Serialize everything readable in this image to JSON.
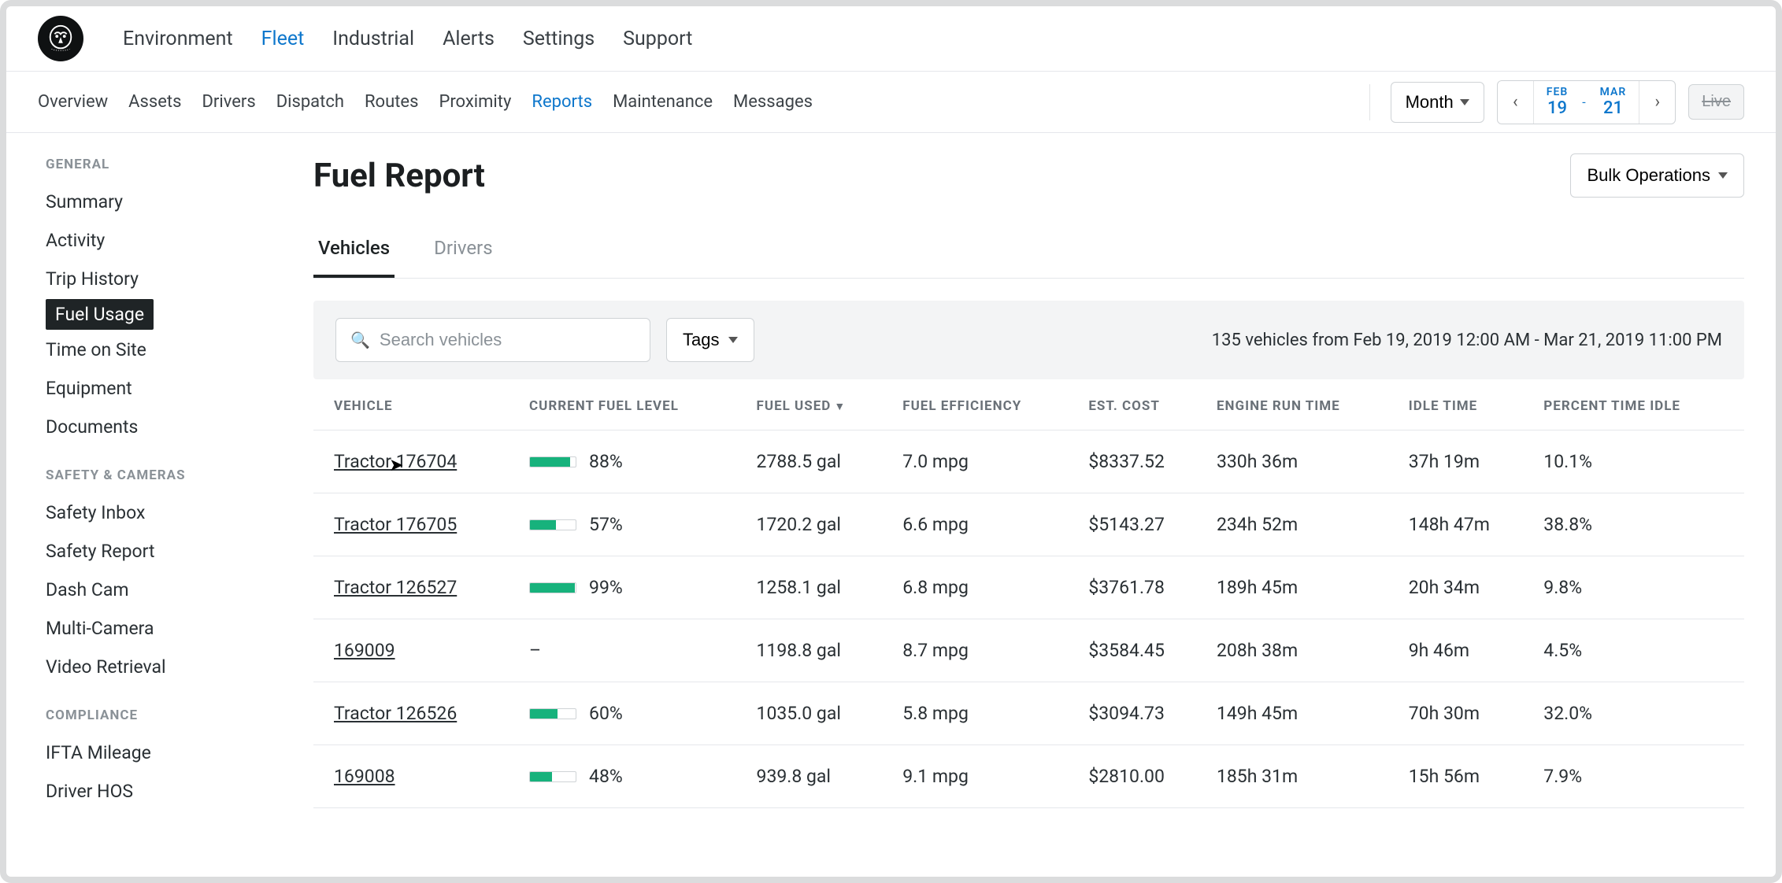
{
  "topNav": {
    "items": [
      "Environment",
      "Fleet",
      "Industrial",
      "Alerts",
      "Settings",
      "Support"
    ],
    "activeIndex": 1
  },
  "subNav": {
    "items": [
      "Overview",
      "Assets",
      "Drivers",
      "Dispatch",
      "Routes",
      "Proximity",
      "Reports",
      "Maintenance",
      "Messages"
    ],
    "activeIndex": 6,
    "monthLabel": "Month",
    "dateFrom": {
      "month": "FEB",
      "day": "19"
    },
    "dateTo": {
      "month": "MAR",
      "day": "21"
    },
    "liveLabel": "Live"
  },
  "sidebar": {
    "sections": [
      {
        "title": "GENERAL",
        "items": [
          "Summary",
          "Activity",
          "Trip History",
          "Fuel Usage",
          "Time on Site",
          "Equipment",
          "Documents"
        ],
        "selected": "Fuel Usage"
      },
      {
        "title": "SAFETY & CAMERAS",
        "items": [
          "Safety Inbox",
          "Safety Report",
          "Dash Cam",
          "Multi-Camera",
          "Video Retrieval"
        ],
        "selected": null
      },
      {
        "title": "COMPLIANCE",
        "items": [
          "IFTA Mileage",
          "Driver HOS"
        ],
        "selected": null
      }
    ]
  },
  "page": {
    "title": "Fuel Report",
    "bulkLabel": "Bulk Operations",
    "tabs": [
      "Vehicles",
      "Drivers"
    ],
    "activeTab": 0,
    "searchPlaceholder": "Search vehicles",
    "tagsLabel": "Tags",
    "summary": "135 vehicles from Feb 19, 2019 12:00 AM - Mar 21, 2019 11:00 PM"
  },
  "table": {
    "columns": [
      "VEHICLE",
      "CURRENT FUEL LEVEL",
      "FUEL USED",
      "FUEL EFFICIENCY",
      "EST. COST",
      "ENGINE RUN TIME",
      "IDLE TIME",
      "PERCENT TIME IDLE"
    ],
    "sortCol": 2,
    "rows": [
      {
        "vehicle": "Tractor 176704",
        "fuelPct": 88,
        "fuelUsed": "2788.5 gal",
        "eff": "7.0 mpg",
        "cost": "$8337.52",
        "run": "330h 36m",
        "idle": "37h 19m",
        "pct": "10.1%"
      },
      {
        "vehicle": "Tractor 176705",
        "fuelPct": 57,
        "fuelUsed": "1720.2 gal",
        "eff": "6.6 mpg",
        "cost": "$5143.27",
        "run": "234h 52m",
        "idle": "148h 47m",
        "pct": "38.8%"
      },
      {
        "vehicle": "Tractor 126527",
        "fuelPct": 99,
        "fuelUsed": "1258.1 gal",
        "eff": "6.8 mpg",
        "cost": "$3761.78",
        "run": "189h 45m",
        "idle": "20h 34m",
        "pct": "9.8%"
      },
      {
        "vehicle": "169009",
        "fuelPct": null,
        "fuelUsed": "1198.8 gal",
        "eff": "8.7 mpg",
        "cost": "$3584.45",
        "run": "208h 38m",
        "idle": "9h 46m",
        "pct": "4.5%"
      },
      {
        "vehicle": "Tractor 126526",
        "fuelPct": 60,
        "fuelUsed": "1035.0 gal",
        "eff": "5.8 mpg",
        "cost": "$3094.73",
        "run": "149h 45m",
        "idle": "70h 30m",
        "pct": "32.0%"
      },
      {
        "vehicle": "169008",
        "fuelPct": 48,
        "fuelUsed": "939.8 gal",
        "eff": "9.1 mpg",
        "cost": "$2810.00",
        "run": "185h 31m",
        "idle": "15h 56m",
        "pct": "7.9%"
      }
    ]
  }
}
